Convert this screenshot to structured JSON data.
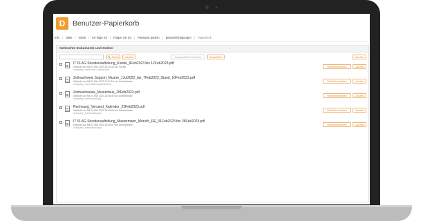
{
  "app": {
    "logo_letter": "D",
    "title": "Benutzer-Papierkorb",
    "accent": "#f29b2e"
  },
  "nav": {
    "items": [
      "Info",
      "Sites",
      "Inhalt",
      "Ich folge (0)",
      "Folgen mir (0)",
      "Passwort ändern",
      "Benachrichtigungen"
    ],
    "current": "Papierkorb"
  },
  "panel": {
    "title": "Gelöschte Dokumente und Ordner"
  },
  "toolbar": {
    "search_placeholder": "",
    "search_label": "Suche",
    "clear_label": "Löschen",
    "empty_selection_label": "Ausgewählte Elemente",
    "select_label": "Auswählen",
    "delete_all_label": "Löschen"
  },
  "rows": [
    {
      "name": "IT IS AG Stundenaufteilung_Kunde_9Feb2023 bis 12Feb2023.pdf",
      "meta": "Gelöscht am Mit 22 Mär 2023 18:10:45 von Gerald",
      "path": "/company_home/user_homes/user",
      "restore": "Wiederherstellen",
      "delete": "Löschen"
    },
    {
      "name": "Zeitnachweis Support_Muster_1Jul2022_bis_7Feb2023_Stand_10Feb2023.pdf",
      "meta": "Gelöscht am Mit 22 Mär 2023 17:34:15 von Administrator",
      "path": "/company_home/dictionary/transfers",
      "restore": "Wiederherstellen",
      "delete": "Löschen"
    },
    {
      "name": "Zeitnachweise_Musterfaus_28Feb2023.pdf",
      "meta": "Gelöscht am Mit 22 Mär 2023 16:08:49 von Administrator",
      "path": "/company_home/dictionary",
      "restore": "Wiederherstellen",
      "delete": "Löschen"
    },
    {
      "name": "Rechnung_Versand_Kalender_23Feb2023.pdf",
      "meta": "Gelöscht am Mit 22 Mär 2023 16:08:36 von Administrator",
      "path": "/company_home/dictionary",
      "restore": "Wiederherstellen",
      "delete": "Löschen"
    },
    {
      "name": "IT IS AG Stundenaufteilung_Mustermann_Munich_RE_01Feb2023 bis 28Feb2023.pdf",
      "meta": "Gelöscht am Mit 22 Mär 2023 16:08:22 von Administrator",
      "path": "/company_home/dictionary",
      "restore": "Wiederherstellen",
      "delete": "Löschen"
    }
  ]
}
